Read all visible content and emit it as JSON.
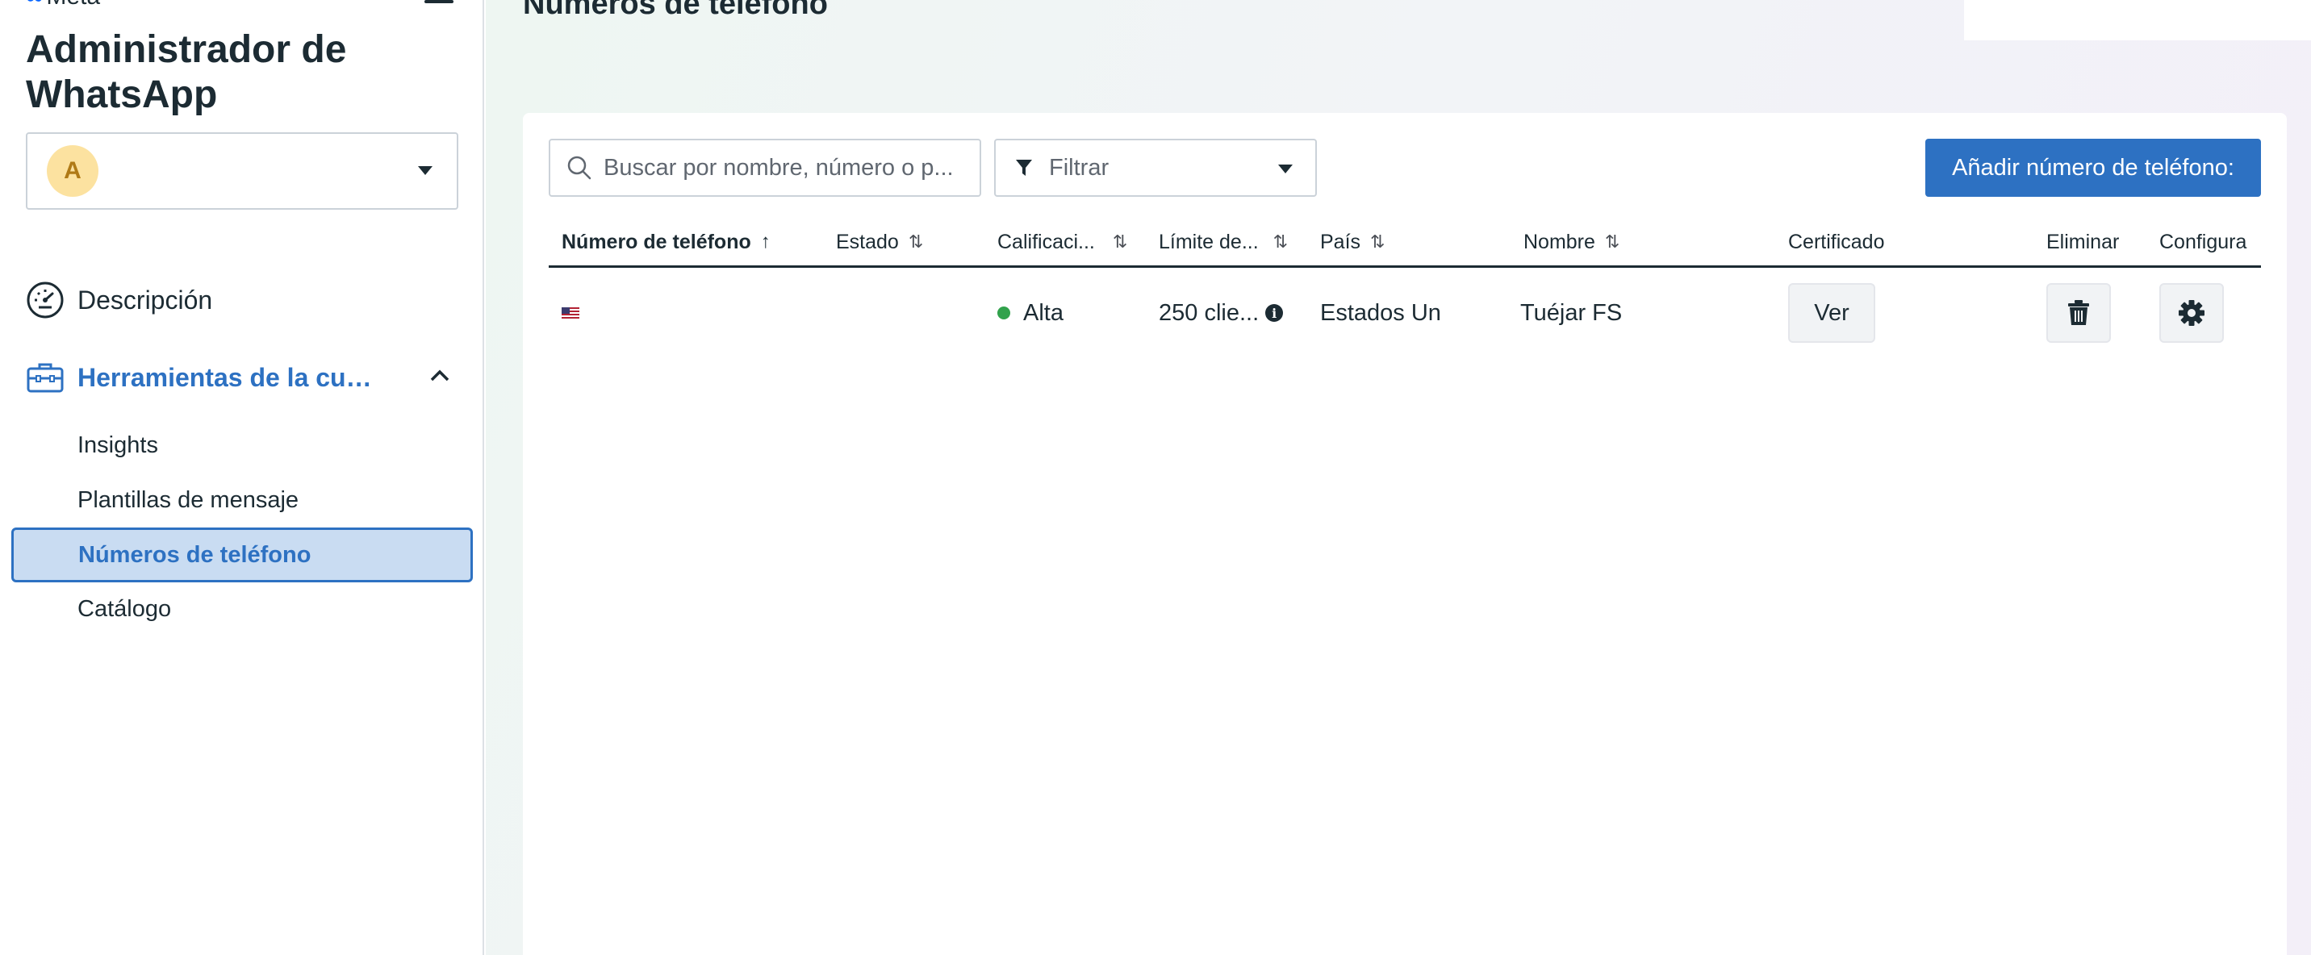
{
  "sidebar": {
    "brand": "Meta",
    "app_title": "Administrador de WhatsApp",
    "account": {
      "avatar_letter": "A"
    },
    "nav": {
      "description": "Descripción",
      "tools": "Herramientas de la cu…"
    },
    "sub_items": [
      "Insights",
      "Plantillas de mensaje",
      "Números de teléfono",
      "Catálogo"
    ],
    "active_item": "Números de teléfono"
  },
  "main": {
    "page_title": "Números de teléfono",
    "search": {
      "placeholder": "Buscar por nombre, número o p..."
    },
    "filter": {
      "label": "Filtrar"
    },
    "add_button": "Añadir número de teléfono:",
    "table": {
      "columns": [
        "Número de teléfono",
        "Estado",
        "Calificaci...",
        "Límite de...",
        "País",
        "Nombre",
        "Certificado",
        "Eliminar",
        "Configura"
      ],
      "sort_active": "↑",
      "sort_idle": "⇅",
      "rows": [
        {
          "phone": "",
          "estado": "",
          "calificacion": "Alta",
          "limite": "250 clie...",
          "pais": "Estados Un",
          "nombre": "Tuéjar FS",
          "certificado": "Ver"
        }
      ]
    }
  },
  "colors": {
    "accent": "#2d71c2",
    "active_bg": "#c9dcf2",
    "status_green": "#31a24c",
    "text": "#1c2b33"
  }
}
